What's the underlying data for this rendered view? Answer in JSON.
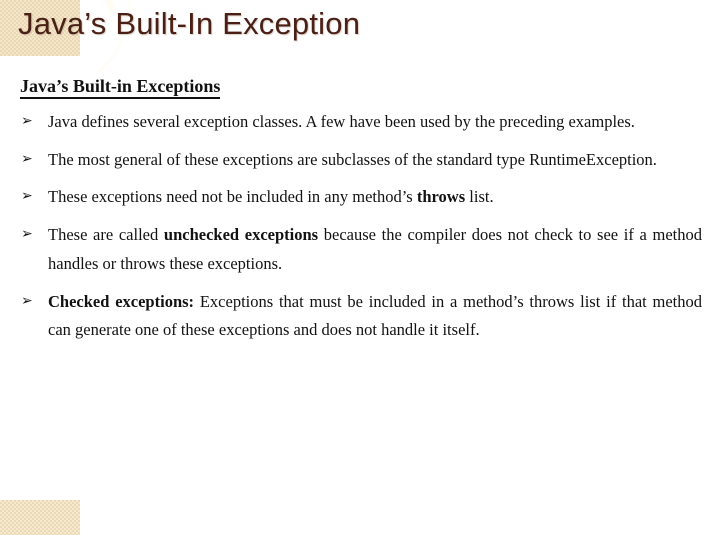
{
  "slide": {
    "title": "Java’s Built-In Exception",
    "title_color": "#4a2016",
    "background_color": "#ffffff",
    "decor_color": "#f3e6cb"
  },
  "content": {
    "heading": "Java’s Built-in Exceptions",
    "bullet_marker": "➢",
    "bullets": [
      {
        "id": "bullet-defines",
        "parts": [
          {
            "text": "Java defines several exception classes. A few have been used by the preceding examples.",
            "bold": false
          }
        ]
      },
      {
        "id": "bullet-runtimeexception",
        "parts": [
          {
            "text": "The most general of these exceptions are subclasses of the standard type RuntimeException.",
            "bold": false
          }
        ]
      },
      {
        "id": "bullet-throws-list",
        "parts": [
          {
            "text": "These exceptions need not be included in any method’s ",
            "bold": false
          },
          {
            "text": "throws",
            "bold": true
          },
          {
            "text": " list.",
            "bold": false
          }
        ]
      },
      {
        "id": "bullet-unchecked",
        "parts": [
          {
            "text": "These are called ",
            "bold": false
          },
          {
            "text": "unchecked exceptions",
            "bold": true
          },
          {
            "text": " because the compiler does not check to see if a method handles or throws these exceptions.",
            "bold": false
          }
        ]
      },
      {
        "id": "bullet-checked",
        "parts": [
          {
            "text": "Checked exceptions:",
            "bold": true
          },
          {
            "text": " Exceptions that must be included in a method’s throws list if that method can generate one of these exceptions and does not handle it itself.",
            "bold": false
          }
        ]
      }
    ]
  }
}
